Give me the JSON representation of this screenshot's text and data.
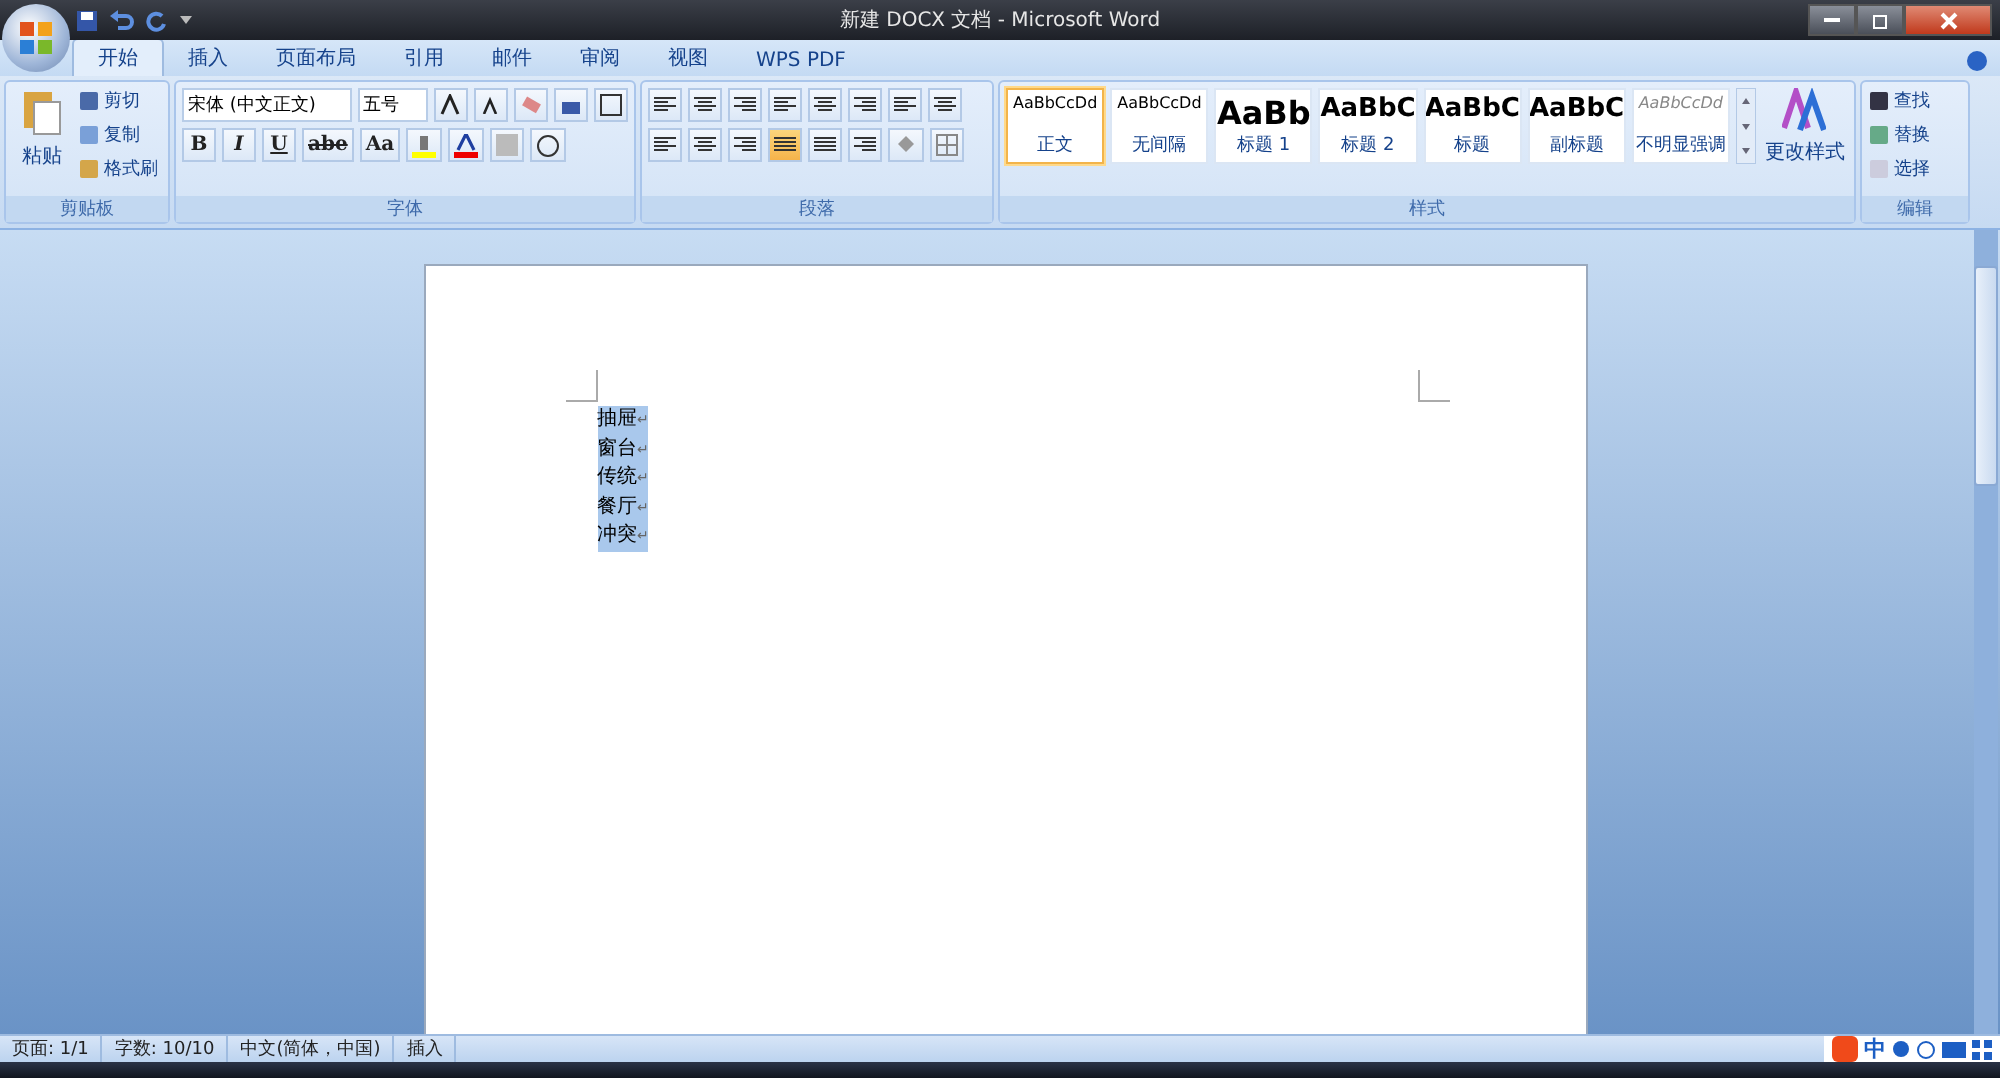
{
  "window": {
    "title": "新建 DOCX 文档 - Microsoft Word"
  },
  "tabs": [
    {
      "label": "开始",
      "selected": true
    },
    {
      "label": "插入",
      "selected": false
    },
    {
      "label": "页面布局",
      "selected": false
    },
    {
      "label": "引用",
      "selected": false
    },
    {
      "label": "邮件",
      "selected": false
    },
    {
      "label": "审阅",
      "selected": false
    },
    {
      "label": "视图",
      "selected": false
    },
    {
      "label": "WPS PDF",
      "selected": false
    }
  ],
  "clipboard": {
    "paste": "粘贴",
    "items": [
      "剪切",
      "复制",
      "格式刷"
    ],
    "label": "剪贴板"
  },
  "font": {
    "family": "宋体 (中文正文)",
    "size": "五号",
    "format_buttons": [
      "B",
      "I",
      "U",
      "abe",
      "Aa"
    ],
    "label": "字体"
  },
  "paragraph": {
    "alignments": [
      {
        "selected": false
      },
      {
        "selected": false
      },
      {
        "selected": false
      },
      {
        "selected": true
      },
      {
        "selected": false
      }
    ],
    "label": "段落"
  },
  "styles": {
    "items": [
      {
        "preview": "AaBbCcDd",
        "name": "正文",
        "selected": true,
        "kind": "normal"
      },
      {
        "preview": "AaBbCcDd",
        "name": "无间隔",
        "selected": false,
        "kind": "normal"
      },
      {
        "preview": "AaBb",
        "name": "标题 1",
        "selected": false,
        "kind": "heading"
      },
      {
        "preview": "AaBbC",
        "name": "标题 2",
        "selected": false,
        "kind": "heading2"
      },
      {
        "preview": "AaBbC",
        "name": "标题",
        "selected": false,
        "kind": "heading2"
      },
      {
        "preview": "AaBbC",
        "name": "副标题",
        "selected": false,
        "kind": "heading2"
      },
      {
        "preview": "AaBbCcDd",
        "name": "不明显强调",
        "selected": false,
        "kind": "subtle"
      }
    ],
    "change": "更改样式",
    "label": "样式"
  },
  "editing": {
    "items": [
      "查找",
      "替换",
      "选择"
    ],
    "label": "编辑"
  },
  "document": {
    "lines": [
      {
        "text": "抽屉",
        "selected": true
      },
      {
        "text": "窗台",
        "selected": true
      },
      {
        "text": "传统",
        "selected": true
      },
      {
        "text": "餐厅",
        "selected": true
      },
      {
        "text": "冲突",
        "selected": true
      }
    ],
    "mark": "↵"
  },
  "status_bar": {
    "items": [
      "页面: 1/1",
      "字数: 10/10",
      "中文(简体，中国)",
      "插入"
    ],
    "ime": "中"
  }
}
